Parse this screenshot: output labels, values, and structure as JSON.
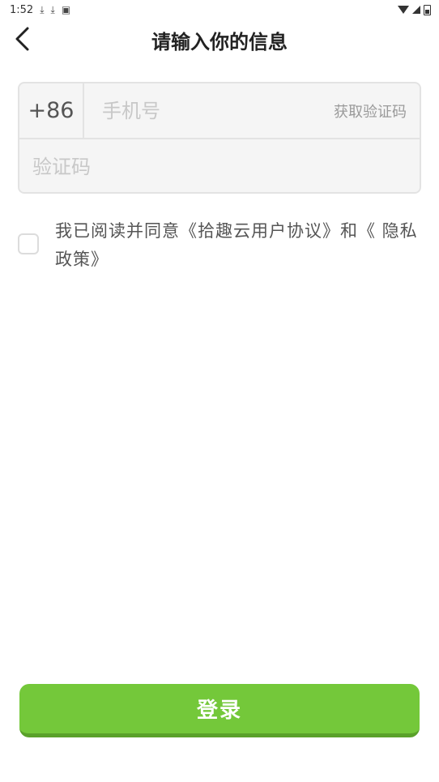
{
  "status_bar": {
    "time": "1:52",
    "notification_icons": [
      "download-icon",
      "download-icon",
      "app-notification-icon"
    ],
    "right_icons": [
      "wifi-icon",
      "signal-icon",
      "battery-icon"
    ]
  },
  "nav": {
    "back_icon": "chevron-left-icon",
    "title": "请输入你的信息"
  },
  "form": {
    "country_code": "+86",
    "phone_placeholder": "手机号",
    "phone_value": "",
    "get_code_label": "获取验证码",
    "code_placeholder": "验证码",
    "code_value": ""
  },
  "agreement": {
    "checked": false,
    "text": "我已阅读并同意《拾趣云用户协议》和《 隐私政策》"
  },
  "login": {
    "label": "登录"
  },
  "colors": {
    "primary_button": "#74c83a",
    "primary_button_shadow": "#5aa12a",
    "input_background": "#f5f5f5",
    "input_border": "#e3e3e3"
  }
}
